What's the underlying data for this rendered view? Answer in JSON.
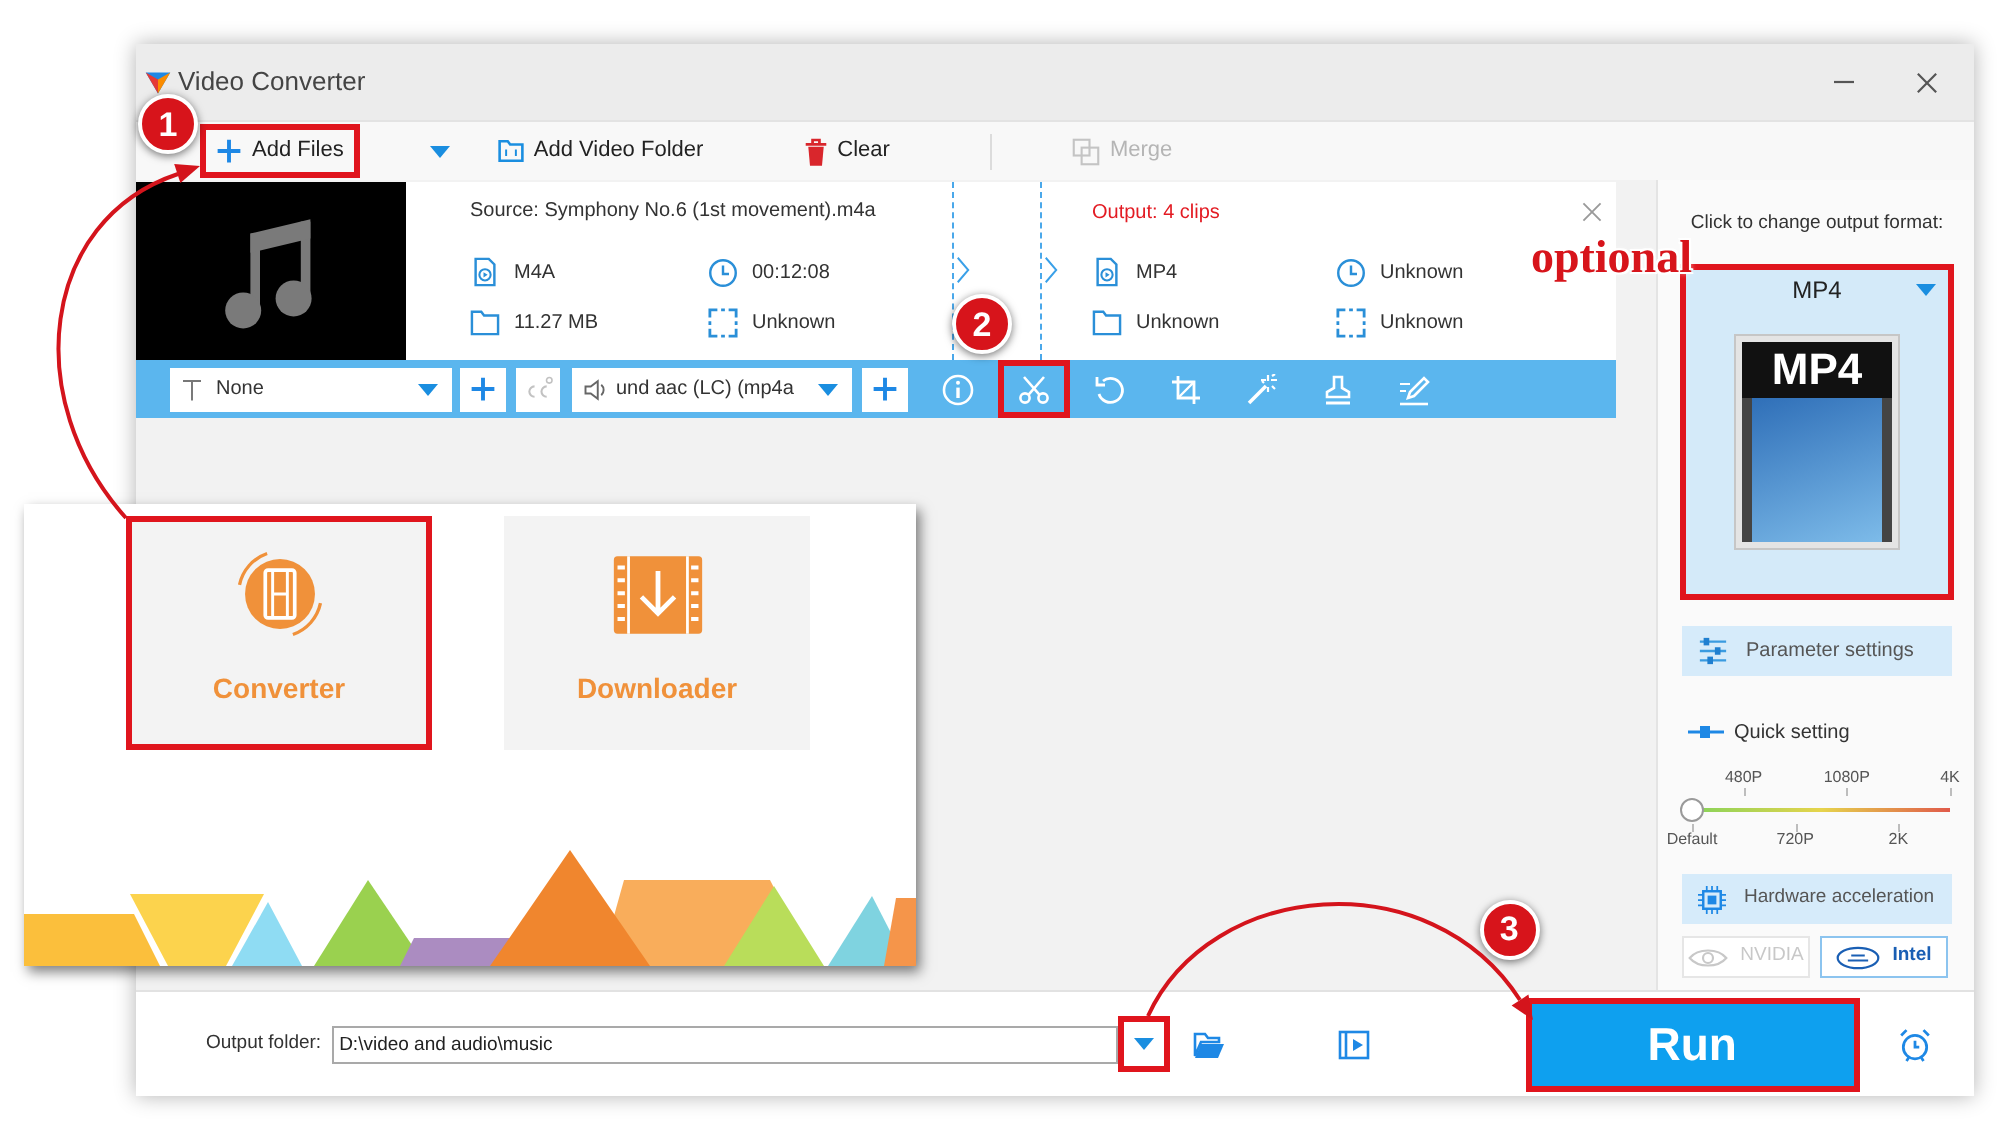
{
  "window": {
    "title": "Video Converter"
  },
  "toolbar": [
    {
      "kind": "add",
      "label": "Add Files",
      "highlighted": true,
      "disabled": false,
      "callout": "1"
    },
    {
      "kind": "menu",
      "highlighted": false,
      "disabled": false
    },
    {
      "kind": "folder",
      "label": "Add Video Folder",
      "highlighted": false,
      "disabled": false
    },
    {
      "kind": "clear",
      "label": "Clear",
      "highlighted": false,
      "disabled": false
    },
    {
      "kind": "merge",
      "label": "Merge",
      "highlighted": false,
      "disabled": true
    }
  ],
  "file": {
    "source": "Source: Symphony No.6 (1st movement).m4a",
    "input": [
      {
        "kind": "format",
        "text": "M4A"
      },
      {
        "kind": "duration",
        "text": "00:12:08"
      },
      {
        "kind": "size",
        "text": "11.27 MB"
      },
      {
        "kind": "resolution",
        "text": "Unknown"
      }
    ],
    "output_title": "Output: 4 clips",
    "output": [
      {
        "kind": "format",
        "text": "MP4"
      },
      {
        "kind": "duration",
        "text": "Unknown"
      },
      {
        "kind": "size",
        "text": "Unknown"
      },
      {
        "kind": "resolution",
        "text": "Unknown"
      }
    ]
  },
  "edit_bar": {
    "subtitle": "None",
    "audio": "und aac (LC) (mp4a",
    "tools": [
      {
        "kind": "info",
        "highlighted": false
      },
      {
        "kind": "cut",
        "highlighted": true,
        "callout": "2"
      },
      {
        "kind": "rotate",
        "highlighted": false
      },
      {
        "kind": "crop",
        "highlighted": false
      },
      {
        "kind": "effects",
        "highlighted": false
      },
      {
        "kind": "watermark",
        "highlighted": false
      },
      {
        "kind": "edit",
        "highlighted": false
      }
    ]
  },
  "format_panel": {
    "hint": "Click to change output format:",
    "format": "MP4",
    "tile_label": "MP4",
    "highlighted": true,
    "note": "optional"
  },
  "parameter_settings": "Parameter settings",
  "quick_setting": {
    "label": "Quick setting",
    "level": 0,
    "ticks": [
      "Default",
      "480P",
      "720P",
      "1080P",
      "2K",
      "4K"
    ]
  },
  "hardware": {
    "label": "Hardware acceleration",
    "options": [
      {
        "kind": "nvidia",
        "label": "NVIDIA",
        "selected": false,
        "disabled": true
      },
      {
        "kind": "intel",
        "label": "Intel",
        "selected": true,
        "disabled": false
      }
    ]
  },
  "output_folder": {
    "label": "Output folder:",
    "value": "D:\\video and audio\\music",
    "dropdown_highlighted": true
  },
  "run": {
    "label": "Run",
    "highlighted": true,
    "callout": "3"
  },
  "launcher_inset": {
    "tiles": [
      {
        "kind": "converter",
        "label": "Converter",
        "highlighted": true
      },
      {
        "kind": "downloader",
        "label": "Downloader",
        "highlighted": false
      }
    ]
  }
}
